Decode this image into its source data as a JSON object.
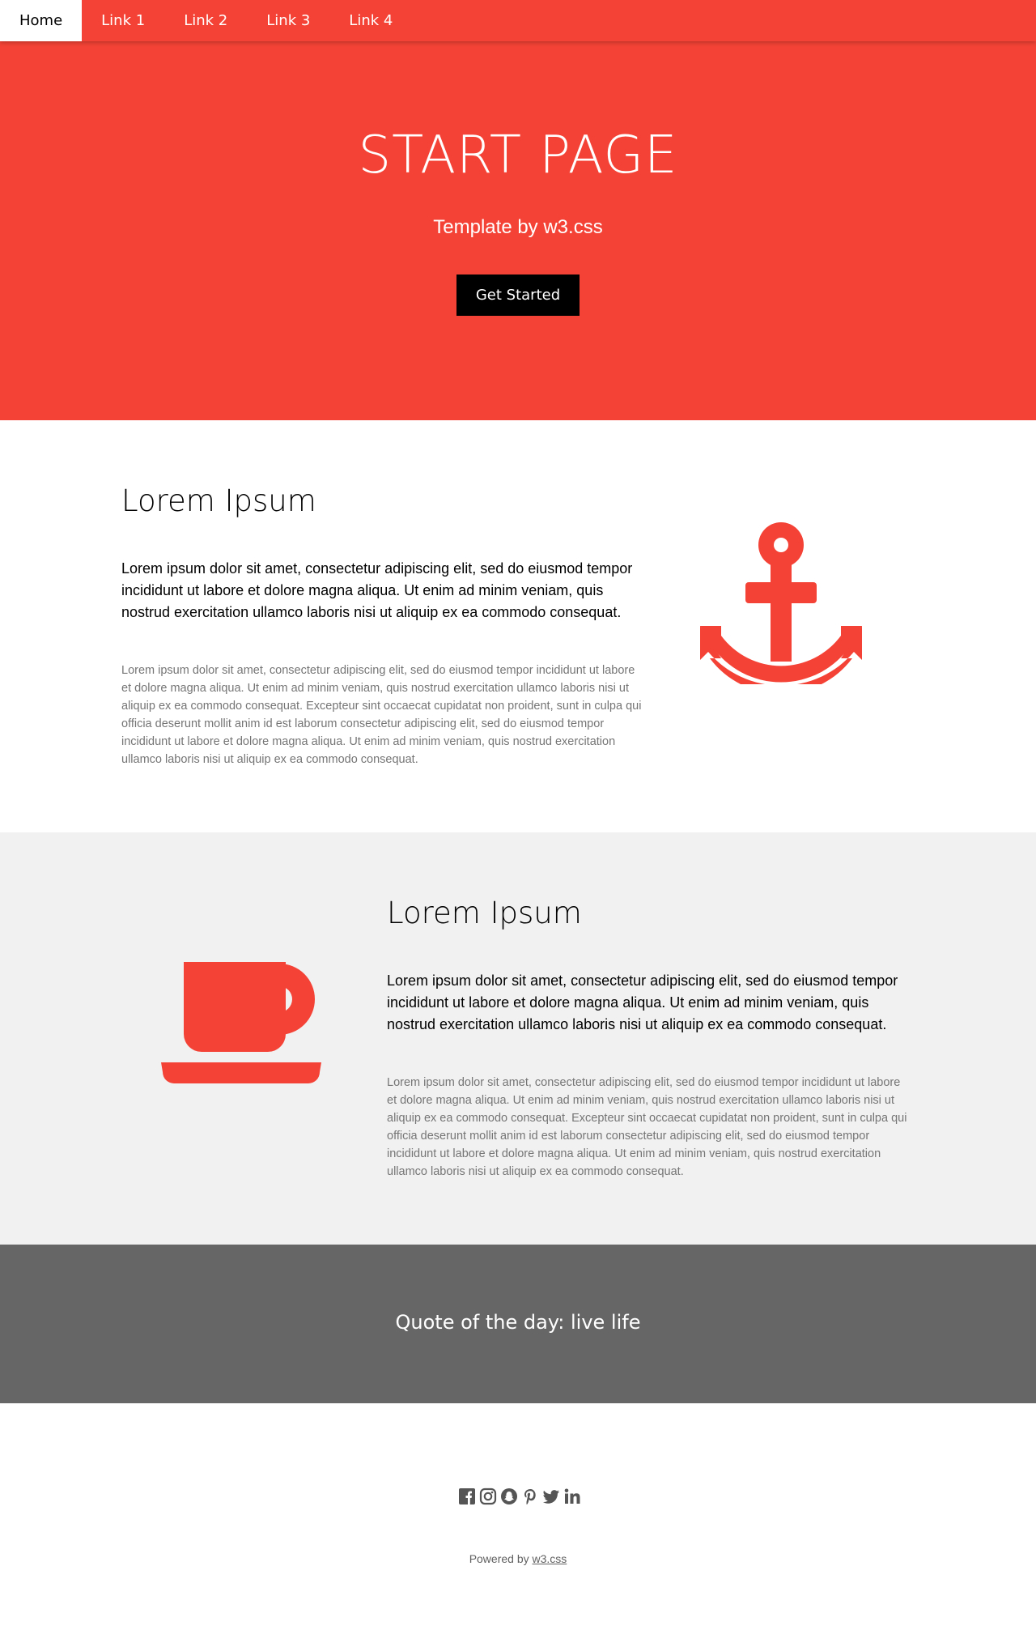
{
  "nav": {
    "items": [
      "Home",
      "Link 1",
      "Link 2",
      "Link 3",
      "Link 4"
    ]
  },
  "hero": {
    "title": "START PAGE",
    "subtitle": "Template by w3.css",
    "button": "Get Started"
  },
  "section1": {
    "heading": "Lorem Ipsum",
    "lead": "Lorem ipsum dolor sit amet, consectetur adipiscing elit, sed do eiusmod tempor incididunt ut labore et dolore magna aliqua. Ut enim ad minim veniam, quis nostrud exercitation ullamco laboris nisi ut aliquip ex ea commodo consequat.",
    "fine": "Lorem ipsum dolor sit amet, consectetur adipiscing elit, sed do eiusmod tempor incididunt ut labore et dolore magna aliqua. Ut enim ad minim veniam, quis nostrud exercitation ullamco laboris nisi ut aliquip ex ea commodo consequat. Excepteur sint occaecat cupidatat non proident, sunt in culpa qui officia deserunt mollit anim id est laborum consectetur adipiscing elit, sed do eiusmod tempor incididunt ut labore et dolore magna aliqua. Ut enim ad minim veniam, quis nostrud exercitation ullamco laboris nisi ut aliquip ex ea commodo consequat.",
    "icon": "anchor-icon"
  },
  "section2": {
    "heading": "Lorem Ipsum",
    "lead": "Lorem ipsum dolor sit amet, consectetur adipiscing elit, sed do eiusmod tempor incididunt ut labore et dolore magna aliqua. Ut enim ad minim veniam, quis nostrud exercitation ullamco laboris nisi ut aliquip ex ea commodo consequat.",
    "fine": "Lorem ipsum dolor sit amet, consectetur adipiscing elit, sed do eiusmod tempor incididunt ut labore et dolore magna aliqua. Ut enim ad minim veniam, quis nostrud exercitation ullamco laboris nisi ut aliquip ex ea commodo consequat. Excepteur sint occaecat cupidatat non proident, sunt in culpa qui officia deserunt mollit anim id est laborum consectetur adipiscing elit, sed do eiusmod tempor incididunt ut labore et dolore magna aliqua. Ut enim ad minim veniam, quis nostrud exercitation ullamco laboris nisi ut aliquip ex ea commodo consequat.",
    "icon": "coffee-icon"
  },
  "quote": {
    "text": "Quote of the day: live life"
  },
  "footer": {
    "social_icons": [
      "facebook-icon",
      "instagram-icon",
      "snapchat-icon",
      "pinterest-icon",
      "twitter-icon",
      "linkedin-icon"
    ],
    "powered_prefix": "Powered by ",
    "powered_link": "w3.css"
  },
  "colors": {
    "accent": "#f44336",
    "gray_band": "#f1f1f1",
    "quote_band": "#666666",
    "icon_gray": "#555555"
  }
}
